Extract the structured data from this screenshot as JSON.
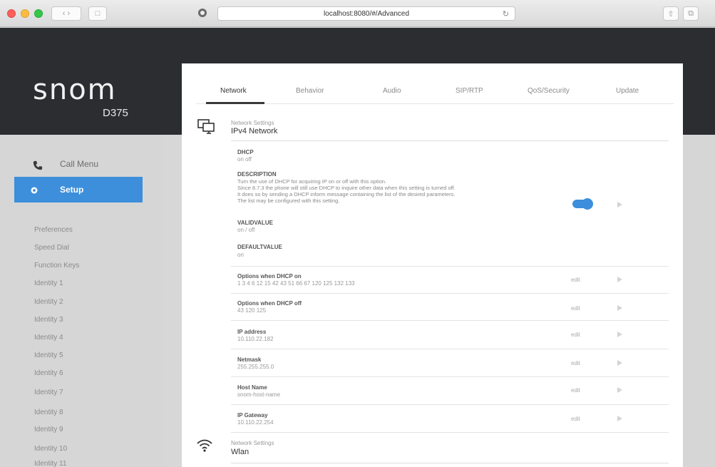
{
  "browser": {
    "url": "localhost:8080/#/Advanced"
  },
  "brand": {
    "logo": "snom",
    "model": "D375",
    "accent": "#3d8fdb"
  },
  "sidebar": {
    "main": [
      {
        "label": "Call Menu",
        "icon": "phone-icon"
      },
      {
        "label": "Setup",
        "icon": "gear-icon",
        "active": true
      }
    ],
    "sub": [
      "Preferences",
      "Speed Dial",
      "Function Keys",
      "Identity 1",
      "Identity 2",
      "Identity 3",
      "Identity 4",
      "Identity 5",
      "Identity 6",
      "Identity 7",
      "Identity 8",
      "Identity 9",
      "Identity 10",
      "Identity 11"
    ]
  },
  "tabs": [
    "Network",
    "Behavior",
    "Audio",
    "SIP/RTP",
    "QoS/Security",
    "Update"
  ],
  "active_tab": "Network",
  "sections": [
    {
      "caption": "Network Settings",
      "title": "IPv4 Network",
      "icon": "monitors-icon"
    },
    {
      "caption": "Network Settings",
      "title": "Wlan",
      "icon": "wifi-icon"
    }
  ],
  "dhcp": {
    "label": "DHCP",
    "value": "on off",
    "desc_label": "DESCRIPTION",
    "description": [
      "Turn the use of DHCP for acquiring IP on or off with this option.",
      "Since 8.7.3 the phone will still use DHCP to inquire other data when this setting is turned off.",
      "It does so by sending a DHCP inform message containing the list of the desired parameters.",
      "The list may be configured with this setting."
    ],
    "valid_label": "VALIDVALUE",
    "valid_value": "on / off",
    "default_label": "DEFAULTVALUE",
    "default_value": "on",
    "enabled": true
  },
  "fields": [
    {
      "label": "Options when DHCP on",
      "value": "1 3 4 6 12 15 42 43 51 66 67 120 125 132 133",
      "action": "edit"
    },
    {
      "label": "Options when DHCP off",
      "value": "43 120 125",
      "action": "edit"
    },
    {
      "label": "IP address",
      "value": "10.110.22.182",
      "action": "edit"
    },
    {
      "label": "Netmask",
      "value": "255.255.255.0",
      "action": "edit"
    },
    {
      "label": "Host Name",
      "value": "snom-host-name",
      "action": "edit"
    },
    {
      "label": "IP Gateway",
      "value": "10.110.22.254",
      "action": "edit"
    }
  ]
}
